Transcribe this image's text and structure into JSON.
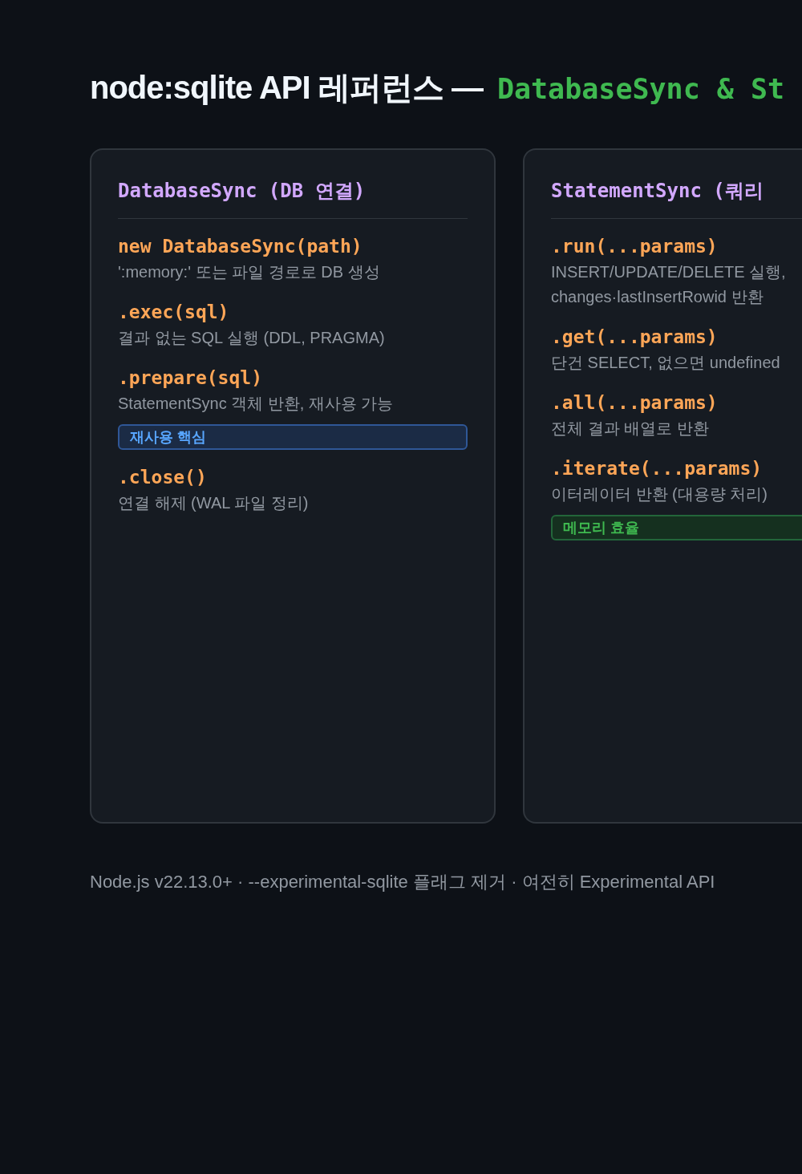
{
  "title": {
    "text": "node:sqlite API 레퍼런스 —",
    "code": "DatabaseSync & St"
  },
  "cards": [
    {
      "title": "DatabaseSync (DB 연결)",
      "methods": [
        {
          "signature": "new DatabaseSync(path)",
          "description": "':memory:' 또는 파일 경로로 DB 생성"
        },
        {
          "signature": ".exec(sql)",
          "description": "결과 없는 SQL 실행 (DDL, PRAGMA)"
        },
        {
          "signature": ".prepare(sql)",
          "description": "StatementSync 객체 반환, 재사용 가능",
          "tag": {
            "kind": "info",
            "text": "재사용 핵심"
          }
        },
        {
          "signature": ".close()",
          "description": "연결 해제 (WAL 파일 정리)"
        }
      ]
    },
    {
      "title": "StatementSync (쿼리",
      "methods": [
        {
          "signature": ".run(...params)",
          "description": "INSERT/UPDATE/DELETE 실행, changes·lastInsertRowid 반환"
        },
        {
          "signature": ".get(...params)",
          "description": "단건 SELECT, 없으면 undefined"
        },
        {
          "signature": ".all(...params)",
          "description": "전체 결과 배열로 반환"
        },
        {
          "signature": ".iterate(...params)",
          "description": "이터레이터 반환 (대용량 처리)",
          "tag": {
            "kind": "success",
            "text": "메모리 효율"
          }
        }
      ]
    }
  ],
  "footer": "Node.js v22.13.0+ · --experimental-sqlite 플래그 제거 · 여전히 Experimental API"
}
